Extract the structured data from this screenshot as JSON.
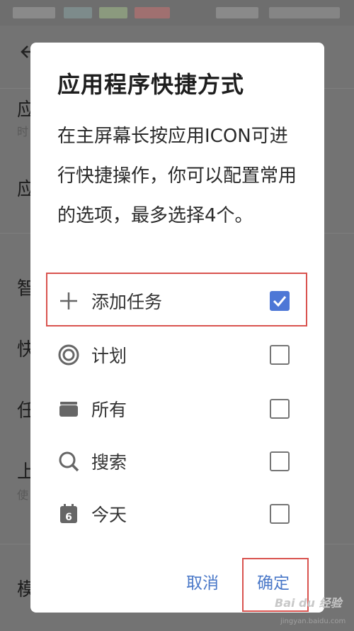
{
  "background": {
    "rows": [
      "应",
      "应",
      "智",
      "快",
      "任",
      "上",
      "模"
    ],
    "subs": [
      "时",
      "使"
    ]
  },
  "dialog": {
    "title": "应用程序快捷方式",
    "message": "在主屏幕长按应用ICON可进行快捷操作，你可以配置常用的选项，最多选择4个。",
    "options": [
      {
        "label": "添加任务",
        "icon": "plus-icon",
        "checked": true
      },
      {
        "label": "计划",
        "icon": "target-icon",
        "checked": false
      },
      {
        "label": "所有",
        "icon": "folder-icon",
        "checked": false
      },
      {
        "label": "搜索",
        "icon": "search-icon",
        "checked": false
      },
      {
        "label": "今天",
        "icon": "calendar-icon",
        "checked": false,
        "icon_text": "6"
      }
    ],
    "cancel_label": "取消",
    "confirm_label": "确定"
  },
  "watermark": {
    "text": "Bai du 经验",
    "url": "jingyan.baidu.com"
  },
  "colors": {
    "accent": "#4a78c8",
    "highlight": "#d9534f"
  }
}
